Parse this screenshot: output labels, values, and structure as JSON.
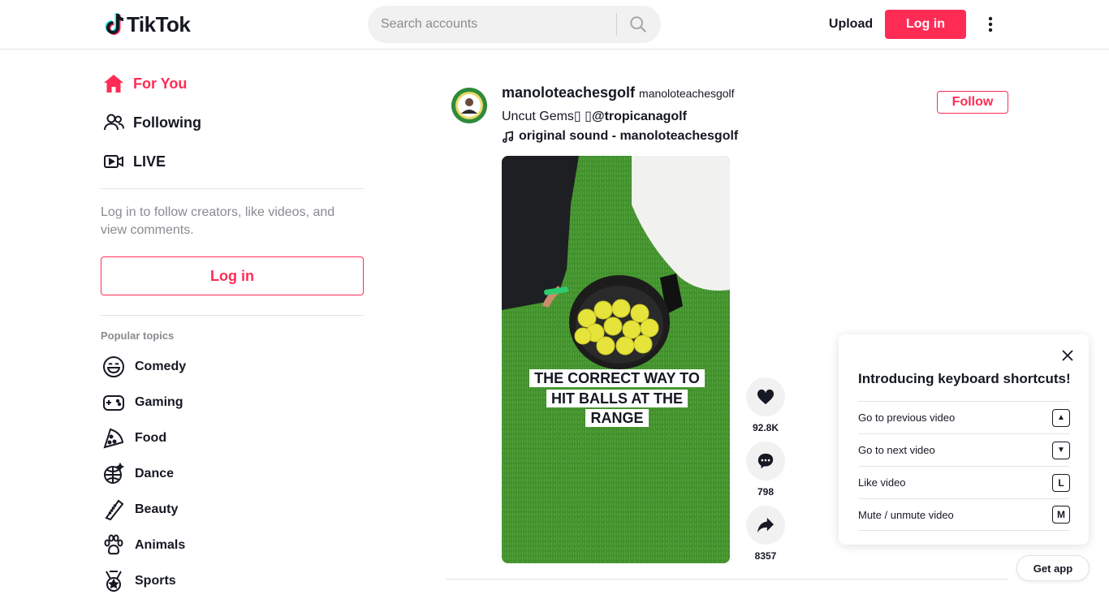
{
  "header": {
    "logo_text": "TikTok",
    "search_placeholder": "Search accounts",
    "upload_label": "Upload",
    "login_label": "Log in"
  },
  "sidebar": {
    "nav": [
      {
        "label": "For You",
        "icon": "home-icon",
        "active": true
      },
      {
        "label": "Following",
        "icon": "people-icon",
        "active": false
      },
      {
        "label": "LIVE",
        "icon": "live-icon",
        "active": false
      }
    ],
    "hint": "Log in to follow creators, like videos, and view comments.",
    "login_label": "Log in",
    "topics_title": "Popular topics",
    "topics": [
      {
        "label": "Comedy",
        "icon": "comedy-icon"
      },
      {
        "label": "Gaming",
        "icon": "gaming-icon"
      },
      {
        "label": "Food",
        "icon": "food-icon"
      },
      {
        "label": "Dance",
        "icon": "dance-icon"
      },
      {
        "label": "Beauty",
        "icon": "beauty-icon"
      },
      {
        "label": "Animals",
        "icon": "animals-icon"
      },
      {
        "label": "Sports",
        "icon": "sports-icon"
      }
    ]
  },
  "post": {
    "author_name": "manoloteachesgolf",
    "author_handle": "manoloteachesgolf",
    "caption_text": "Uncut Gems▯ ▯",
    "caption_mention": "@tropicanagolf",
    "music": "original sound - manoloteachesgolf",
    "follow_label": "Follow",
    "video_overlay_text": "THE CORRECT WAY TO HIT BALLS AT THE RANGE",
    "likes": "92.8K",
    "comments": "798",
    "shares": "8357"
  },
  "shortcuts": {
    "title": "Introducing keyboard shortcuts!",
    "items": [
      {
        "label": "Go to previous video",
        "key": "▲"
      },
      {
        "label": "Go to next video",
        "key": "▼"
      },
      {
        "label": "Like video",
        "key": "L"
      },
      {
        "label": "Mute / unmute video",
        "key": "M"
      }
    ]
  },
  "getapp_label": "Get app",
  "colors": {
    "brand": "#fe2c55",
    "text": "#161823",
    "muted": "#8a8b91",
    "surface": "#f1f1f2"
  }
}
